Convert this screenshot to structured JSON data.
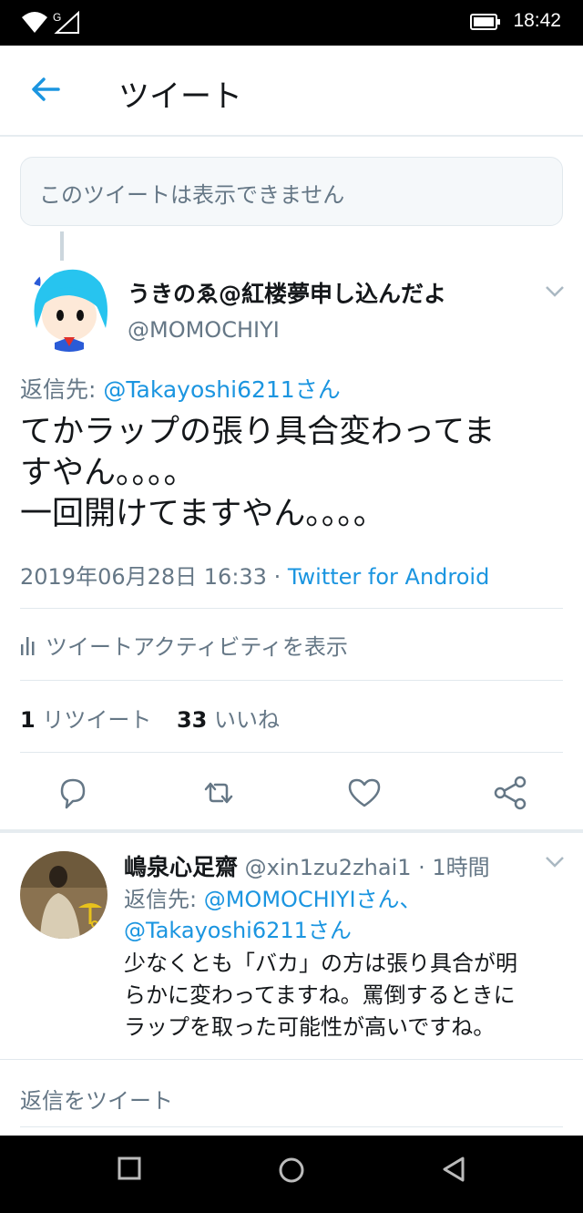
{
  "status_bar": {
    "time": "18:42",
    "network_label": "G",
    "icons": [
      "wifi-icon",
      "signal-icon",
      "battery-icon"
    ]
  },
  "app_bar": {
    "back_icon": "arrow-left-icon",
    "title": "ツイート"
  },
  "unavailable_tweet": {
    "text": "このツイートは表示できません"
  },
  "main_tweet": {
    "display_name": "うきのゑ@紅楼夢申し込んだよ",
    "handle": "@MOMOCHIYI",
    "reply_prefix": "返信先: ",
    "reply_to": "@Takayoshi6211さん",
    "text_lines": [
      "てかラップの張り具合変わってま",
      "すやん。。。。",
      "一回開けてますやん。。。。"
    ],
    "timestamp": "2019年06月28日 16:33 · ",
    "source": "Twitter for Android",
    "activity_label": "ツイートアクティビティを表示",
    "retweet_count": "1",
    "retweet_label": " リツイート",
    "like_count": "33",
    "like_label": " いいね"
  },
  "actions": [
    "reply-icon",
    "retweet-icon",
    "like-icon",
    "share-icon"
  ],
  "reply": {
    "display_name": "嶋泉心足齋",
    "handle_time": " @xin1zu2zhai1 · 1時間",
    "reply_prefix": "返信先: ",
    "reply_to_1": "@MOMOCHIYIさん、",
    "reply_to_2": "@Takayoshi6211さん",
    "text_lines": [
      "少なくとも「バカ」の方は張り具合が明",
      "らかに変わってますね。罵倒するときに",
      "ラップを取った可能性が高いですね。"
    ]
  },
  "compose": {
    "placeholder": "返信をツイート"
  },
  "colors": {
    "accent": "#1b95e0",
    "secondary_text": "#657786",
    "primary_text": "#14171a",
    "divider": "#e1e8ed"
  },
  "nav_bar": [
    "square-recents-icon",
    "circle-home-icon",
    "triangle-back-icon"
  ]
}
